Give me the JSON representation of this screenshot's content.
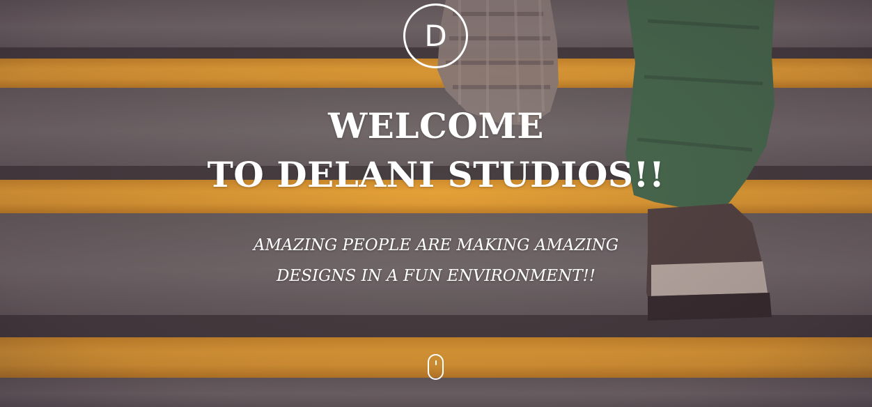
{
  "hero": {
    "logo_letter": "D",
    "headline_line1": "WELCOME",
    "headline_line2": "TO DELANI STUDIOS!!",
    "tagline_line1": "AMAZING PEOPLE ARE MAKING AMAZING",
    "tagline_line2": "DESIGNS IN A FUN ENVIRONMENT!!"
  },
  "icons": {
    "logo": "logo-d-circle-icon",
    "scroll": "scroll-down-mouse-icon"
  },
  "colors": {
    "stripe": "#f1a82a",
    "step": "#6f6a66",
    "text": "#ffffff",
    "pants": "#3d6a45",
    "shoe": "#4a3e37"
  }
}
